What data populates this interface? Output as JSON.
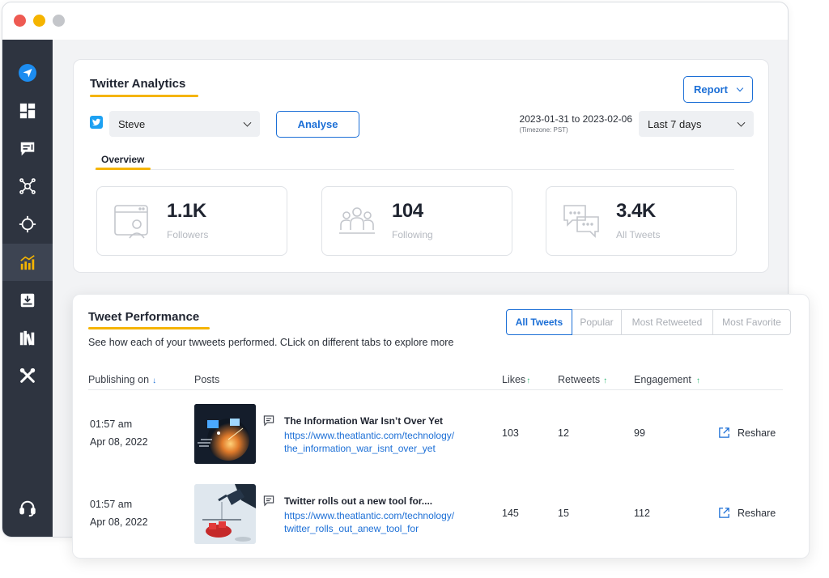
{
  "window": {
    "buttons": [
      "close",
      "minimize",
      "maximize"
    ]
  },
  "colors": {
    "accent": "#1c6fd6",
    "underline": "#f5b400",
    "sidebar": "#2e3440",
    "positive": "#2bb673"
  },
  "sidebar": {
    "items": [
      {
        "icon": "send-logo-icon"
      },
      {
        "icon": "dashboard-icon"
      },
      {
        "icon": "compose-icon"
      },
      {
        "icon": "network-icon"
      },
      {
        "icon": "target-icon"
      },
      {
        "icon": "analytics-icon",
        "active": true
      },
      {
        "icon": "inbox-icon"
      },
      {
        "icon": "library-icon"
      },
      {
        "icon": "tools-icon"
      },
      {
        "icon": "support-headset-icon"
      }
    ]
  },
  "analytics": {
    "title": "Twitter Analytics",
    "report_label": "Report",
    "account": {
      "icon": "twitter-icon",
      "name": "Steve"
    },
    "analyse_label": "Analyse",
    "date_range": "2023-01-31 to 2023-02-06",
    "timezone": "(Timezone: PST)",
    "period": "Last 7 days",
    "tab_overview": "Overview",
    "stats": [
      {
        "value": "1.1K",
        "label": "Followers",
        "icon": "profile-window-icon"
      },
      {
        "value": "104",
        "label": "Following",
        "icon": "people-group-icon"
      },
      {
        "value": "3.4K",
        "label": "All Tweets",
        "icon": "chat-bubbles-icon"
      }
    ]
  },
  "performance": {
    "title": "Tweet Performance",
    "subtitle": "See how each of your twweets performed. CLick on different tabs to explore more",
    "tabs": [
      "All Tweets",
      "Popular",
      "Most Retweeted",
      "Most Favorite"
    ],
    "columns": {
      "date": "Publishing on",
      "posts": "Posts",
      "likes": "Likes",
      "retweets": "Retweets",
      "engagement": "Engagement"
    },
    "rows": [
      {
        "time": "01:57 am",
        "date": "Apr 08, 2022",
        "title": "The Information War Isn’t Over Yet",
        "link_line1": "https://www.theatlantic.com/technology/",
        "link_line2": "the_information_war_isnt_over_yet",
        "likes": "103",
        "retweets": "12",
        "engagement": "99",
        "action": "Reshare"
      },
      {
        "time": "01:57 am",
        "date": "Apr 08, 2022",
        "title": "Twitter rolls out a new tool for....",
        "link_line1": "https://www.theatlantic.com/technology/",
        "link_line2": "twitter_rolls_out_anew_tool_for",
        "likes": "145",
        "retweets": "15",
        "engagement": "112",
        "action": "Reshare"
      }
    ]
  }
}
